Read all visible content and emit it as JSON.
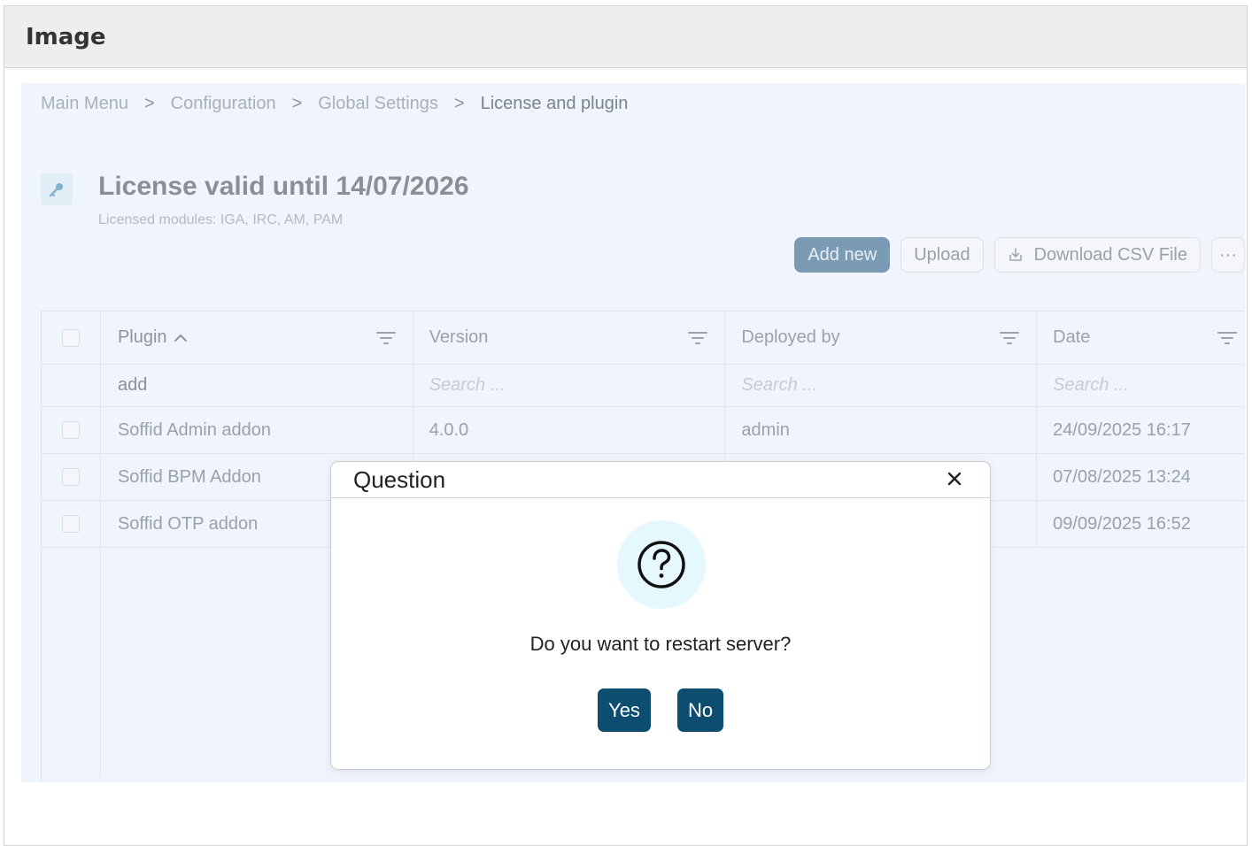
{
  "frame": {
    "title": "Image"
  },
  "breadcrumb": [
    {
      "label": "Main Menu"
    },
    {
      "label": "Configuration"
    },
    {
      "label": "Global Settings"
    },
    {
      "label": "License and plugin"
    }
  ],
  "breadcrumb_separator": ">",
  "page": {
    "title": "License valid until 14/07/2026",
    "subtitle": "Licensed modules: IGA, IRC, AM, PAM"
  },
  "toolbar": {
    "add_new": "Add new",
    "upload": "Upload",
    "download_csv": "Download CSV File",
    "more": "···"
  },
  "table": {
    "columns": [
      {
        "label": "Plugin",
        "sorted": "ascending",
        "filter_value": "add"
      },
      {
        "label": "Version",
        "filter_placeholder": "Search ..."
      },
      {
        "label": "Deployed by",
        "filter_placeholder": "Search ..."
      },
      {
        "label": "Date",
        "filter_placeholder": "Search ..."
      }
    ],
    "rows": [
      {
        "plugin": "Soffid Admin addon",
        "version": "4.0.0",
        "deployed_by": "admin",
        "date": "24/09/2025 16:17"
      },
      {
        "plugin": "Soffid BPM Addon",
        "version": "",
        "deployed_by": "",
        "date": "07/08/2025 13:24"
      },
      {
        "plugin": "Soffid OTP addon",
        "version": "",
        "deployed_by": "",
        "date": "09/09/2025 16:52"
      }
    ]
  },
  "dialog": {
    "title": "Question",
    "message": "Do you want to restart server?",
    "yes": "Yes",
    "no": "No"
  },
  "colors": {
    "primary_dark": "#0d4d70",
    "primary_muted": "#7a9bb3",
    "app_background": "#f0f4fc",
    "question_circle": "#e4f8fd"
  },
  "icons": {
    "page": "key-icon",
    "sort": "chevron-up-icon",
    "filter": "filter-icon",
    "download": "download-icon",
    "close": "close-icon",
    "question": "question-circle-icon"
  }
}
